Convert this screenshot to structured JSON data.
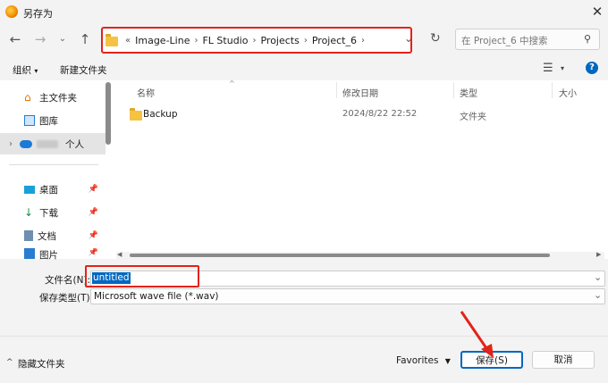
{
  "window": {
    "title": "另存为"
  },
  "nav": {
    "back_icon": "arrow-left-icon",
    "forward_icon": "arrow-right-icon",
    "recent_icon": "chevron-down-icon",
    "up_icon": "arrow-up-icon"
  },
  "address": {
    "prefix": "«",
    "crumbs": [
      "Image-Line",
      "FL Studio",
      "Projects",
      "Project_6"
    ]
  },
  "search": {
    "placeholder": "在 Project_6 中搜索"
  },
  "toolbar": {
    "organize": "组织",
    "new_folder": "新建文件夹"
  },
  "sidebar": {
    "items": [
      {
        "label": "主文件夹",
        "icon": "home-icon"
      },
      {
        "label": "图库",
        "icon": "gallery-icon"
      },
      {
        "label": "个人",
        "icon": "cloud-icon"
      },
      {
        "label": "桌面",
        "icon": "desktop-icon"
      },
      {
        "label": "下载",
        "icon": "download-icon"
      },
      {
        "label": "文档",
        "icon": "document-icon"
      },
      {
        "label": "图片",
        "icon": "picture-icon"
      }
    ]
  },
  "columns": {
    "name": "名称",
    "modified": "修改日期",
    "type": "类型",
    "size": "大小"
  },
  "files": [
    {
      "name": "Backup",
      "modified": "2024/8/22 22:52",
      "type": "文件夹"
    }
  ],
  "filename": {
    "label": "文件名(N):",
    "value": "untitled"
  },
  "filetype": {
    "label": "保存类型(T):",
    "value": "Microsoft wave file (*.wav)"
  },
  "footer": {
    "hide_folders": "隐藏文件夹",
    "favorites": "Favorites",
    "save": "保存(S)",
    "cancel": "取消"
  },
  "colors": {
    "highlight": "#e2231a",
    "selection": "#0067c0",
    "accent": "#0067c0"
  }
}
